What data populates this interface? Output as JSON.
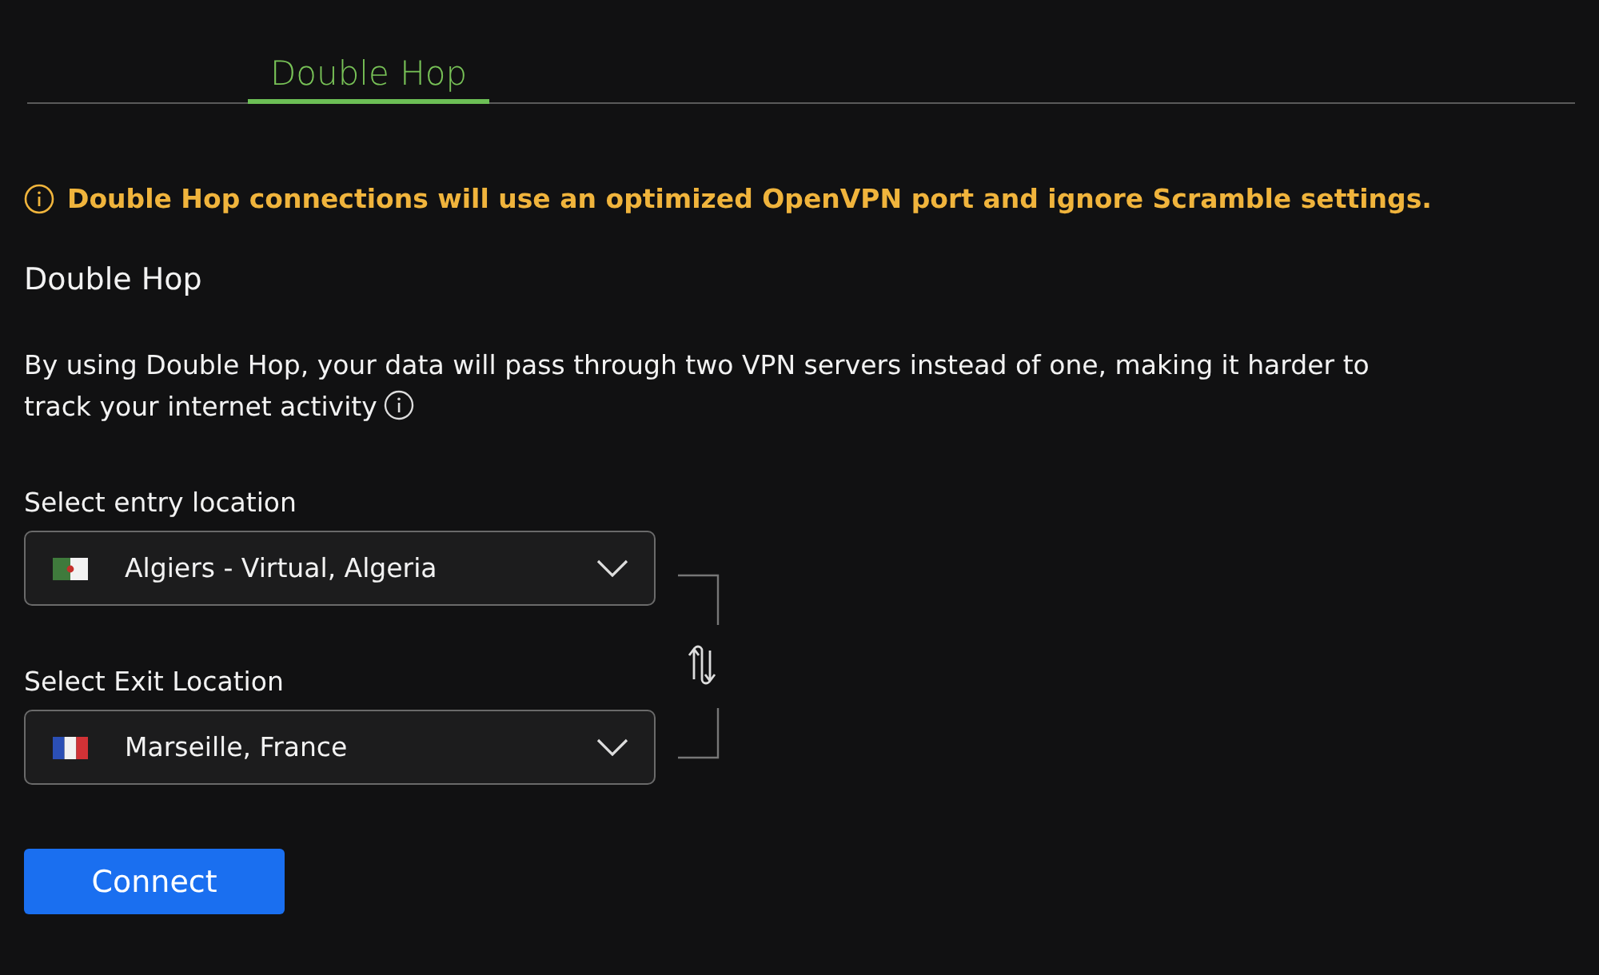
{
  "tabs": [
    {
      "label": "Double Hop",
      "selected": true
    }
  ],
  "warning": {
    "text": "Double Hop connections will use an optimized OpenVPN port and ignore Scramble settings."
  },
  "heading": "Double Hop",
  "description_lines": [
    "By using Double Hop, your data will pass through two VPN servers instead of one, making it harder to",
    "track your internet activity"
  ],
  "locations": [
    {
      "label": "Select entry location",
      "value": "Algiers - Virtual, Algeria"
    },
    {
      "label": "Select Exit Location",
      "value": "Marseille, France"
    }
  ],
  "connect_button": "Connect"
}
